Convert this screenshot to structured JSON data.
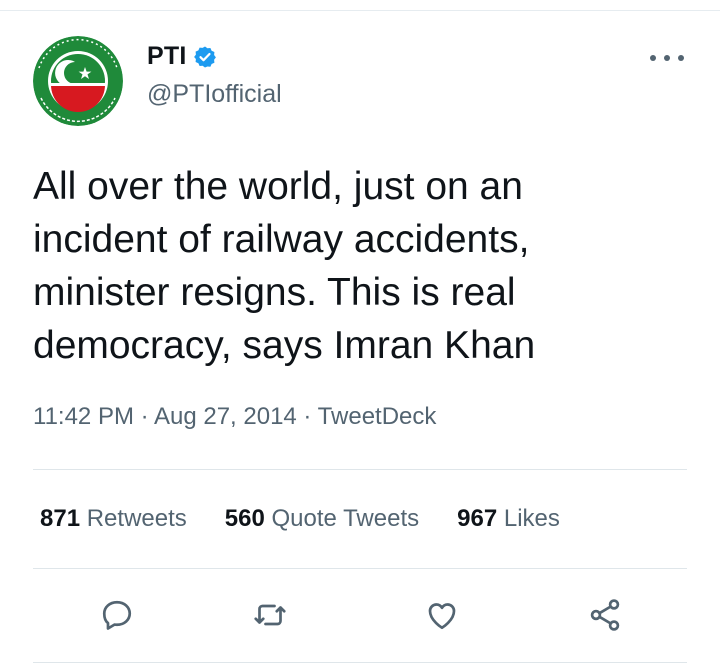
{
  "tweet": {
    "author": {
      "display_name": "PTI",
      "handle": "@PTIofficial",
      "verified": true,
      "avatar_text_top": "پاکستان تحریک انصاف",
      "avatar_text_bottom": "Pakistan Tehreek-e-Insaf"
    },
    "text": "All over the world, just on an\nincident of railway accidents,\nminister resigns. This is real\ndemocracy, says Imran Khan",
    "time": "11:42 PM",
    "date": "Aug 27, 2014",
    "source": "TweetDeck",
    "separator": " · "
  },
  "stats": {
    "retweets_count": "871",
    "retweets_label": "Retweets",
    "quotes_count": "560",
    "quotes_label": "Quote Tweets",
    "likes_count": "967",
    "likes_label": "Likes"
  },
  "actions": [
    "reply-icon",
    "retweet-icon",
    "like-icon",
    "share-icon"
  ],
  "colors": {
    "verified": "#1d9bf0",
    "secondary_text": "#536471",
    "avatar_green": "#1f8a3a",
    "avatar_red": "#d71920"
  }
}
